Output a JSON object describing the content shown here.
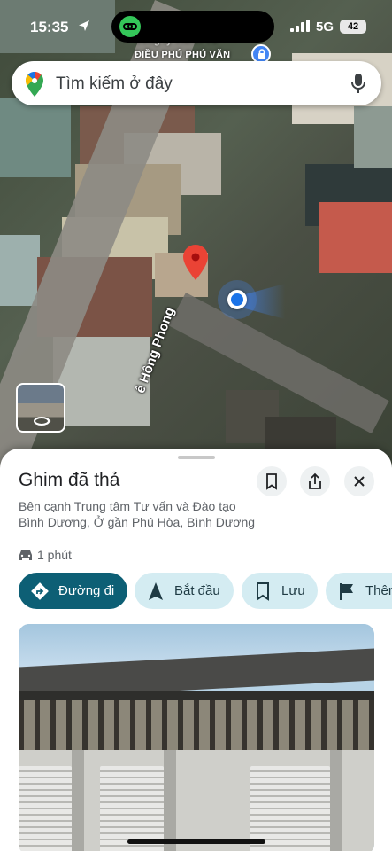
{
  "status_bar": {
    "time": "15:35",
    "network": "5G",
    "battery": "42"
  },
  "map": {
    "business_label_line1": "Công ty TNHH Tư",
    "business_label_line2": "ĐIỀU PHÚ PHÚ VĂN",
    "street_label": "ê Hồng Phong",
    "colors": {
      "pin": "#ea4335",
      "location": "#1a73e8"
    }
  },
  "search": {
    "placeholder": "Tìm kiếm ở đây"
  },
  "sheet": {
    "title": "Ghim đã thả",
    "description": "Bên cạnh Trung tâm Tư vấn và Đào tạo Bình Dương, Ở gần Phú Hòa, Bình Dương",
    "eta": "1 phút",
    "actions": [
      {
        "label": "Đường đi",
        "icon": "directions-icon"
      },
      {
        "label": "Bắt đầu",
        "icon": "navigation-arrow-icon"
      },
      {
        "label": "Lưu",
        "icon": "bookmark-icon"
      },
      {
        "label": "Thêm",
        "icon": "flag-icon"
      }
    ],
    "accent_color": "#0d5f75"
  }
}
